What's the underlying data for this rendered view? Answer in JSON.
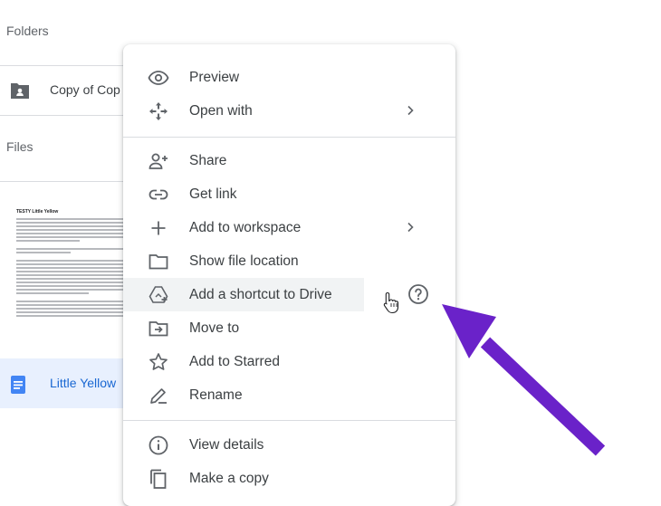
{
  "sidebar": {
    "folders_label": "Folders",
    "files_label": "Files",
    "folder_name": "Copy of Cop",
    "file_name": "Little Yellow",
    "doc_title": "TESTY Little Yellow"
  },
  "menu": {
    "items": [
      {
        "label": "Preview",
        "icon": "eye-icon"
      },
      {
        "label": "Open with",
        "icon": "open-with-icon"
      },
      {
        "label": "Share",
        "icon": "person-add-icon"
      },
      {
        "label": "Get link",
        "icon": "link-icon"
      },
      {
        "label": "Add to workspace",
        "icon": "plus-icon"
      },
      {
        "label": "Show file location",
        "icon": "folder-icon"
      },
      {
        "label": "Add a shortcut to Drive",
        "icon": "add-shortcut-icon"
      },
      {
        "label": "Move to",
        "icon": "move-to-icon"
      },
      {
        "label": "Add to Starred",
        "icon": "star-icon"
      },
      {
        "label": "Rename",
        "icon": "rename-icon"
      },
      {
        "label": "View details",
        "icon": "info-icon"
      },
      {
        "label": "Make a copy",
        "icon": "copy-icon"
      }
    ]
  },
  "colors": {
    "accent": "#1967d2",
    "annotation_arrow": "#6a22c9",
    "hover": "#f1f3f4"
  }
}
